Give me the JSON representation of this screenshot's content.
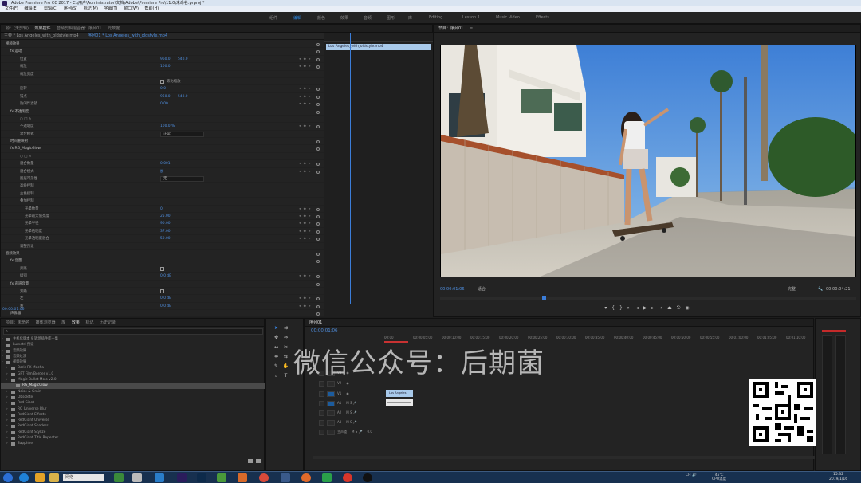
{
  "window": {
    "title": "Adobe Premiere Pro CC 2017 - C:\\用户\\Administrator\\文档\\Adobe\\Premiere Pro\\11.0\\未命名.prproj *"
  },
  "menu": [
    "文件(F)",
    "编辑(E)",
    "剪辑(C)",
    "序列(S)",
    "标记(M)",
    "字幕(T)",
    "窗口(W)",
    "帮助(H)"
  ],
  "workspaces": [
    "组件",
    "编辑",
    "颜色",
    "效果",
    "音频",
    "图形",
    "库",
    "Editing",
    "Lesson 1",
    "Music Video",
    "Effects"
  ],
  "workspace_active": "编辑",
  "effect_controls": {
    "tabs": [
      "源：(无剪辑)",
      "效果控件",
      "音频剪辑混合器：序列01",
      "元数据"
    ],
    "source_clip": "主要 * Los Angeles_with_oldstyle.mp4",
    "sequence_clip": "序列01 * Los Angeles_with_oldstyle.mp4",
    "timeline_clip": "Los Angeles_with_oldstyle.mp4",
    "timecode": "00:00:01:06",
    "rows": [
      {
        "label": "视频效果",
        "indent": 1,
        "section": true
      },
      {
        "label": "fx 运动",
        "indent": 2,
        "section": true
      },
      {
        "label": "位置",
        "indent": 4,
        "value": "960.0",
        "value2": "540.0"
      },
      {
        "label": "缩放",
        "indent": 4,
        "value": "100.0"
      },
      {
        "label": "缩放宽度",
        "indent": 4
      },
      {
        "label": "",
        "indent": 4,
        "check": "等比缩放"
      },
      {
        "label": "旋转",
        "indent": 4,
        "value": "0.0"
      },
      {
        "label": "锚点",
        "indent": 4,
        "value": "960.0",
        "value2": "540.0"
      },
      {
        "label": "防闪烁滤镜",
        "indent": 4,
        "value": "0.00"
      },
      {
        "label": "fx 不透明度",
        "indent": 2,
        "section": true
      },
      {
        "label": "○ □ ✎",
        "indent": 4
      },
      {
        "label": "不透明度",
        "indent": 4,
        "value": "100.0 %"
      },
      {
        "label": "混合模式",
        "indent": 4,
        "dropdown": "正常"
      },
      {
        "label": "时间重映射",
        "indent": 2,
        "section": true
      },
      {
        "label": "fx RG_MagicGlow",
        "indent": 2,
        "section": true
      },
      {
        "label": "○ □ ✎",
        "indent": 4
      },
      {
        "label": "混合数量",
        "indent": 4,
        "value": "0.001"
      },
      {
        "label": "混合模式",
        "indent": 4,
        "value": "加"
      },
      {
        "label": "图层可见性",
        "indent": 4,
        "dropdown": "无"
      },
      {
        "label": "高级控制",
        "indent": 4
      },
      {
        "label": "主色控制",
        "indent": 4
      },
      {
        "label": "叠加控制",
        "indent": 4
      },
      {
        "label": "光晕数量",
        "indent": 5,
        "value": "0"
      },
      {
        "label": "光晕最大值亮度",
        "indent": 5,
        "value": "25.00"
      },
      {
        "label": "光晕半径",
        "indent": 5,
        "value": "90.00"
      },
      {
        "label": "光晕透明度",
        "indent": 5,
        "value": "37.00"
      },
      {
        "label": "光晕透明度混合",
        "indent": 5,
        "value": "50.00"
      },
      {
        "label": "调整预设",
        "indent": 4
      },
      {
        "label": "音频效果",
        "indent": 1,
        "section": true
      },
      {
        "label": "fx 音量",
        "indent": 2,
        "section": true
      },
      {
        "label": "旁路",
        "indent": 4,
        "chk": true
      },
      {
        "label": "级别",
        "indent": 4,
        "value": "0.0 dB"
      },
      {
        "label": "fx 声道音量",
        "indent": 2,
        "section": true
      },
      {
        "label": "旁路",
        "indent": 4,
        "chk": true
      },
      {
        "label": "左",
        "indent": 4,
        "value": "0.0 dB"
      },
      {
        "label": "右",
        "indent": 4,
        "value": "0.0 dB"
      },
      {
        "label": "声像器",
        "indent": 2,
        "section": true
      },
      {
        "label": "平衡",
        "indent": 4,
        "value": "0.0"
      }
    ]
  },
  "program_monitor": {
    "tab": "节目：序列01",
    "timecode": "00:00:01:06",
    "fit_label": "适合",
    "full_label": "完整",
    "duration": "00:00:04:21"
  },
  "project_panel": {
    "tabs": [
      "项目：未命名",
      "媒体浏览器",
      "库",
      "效果",
      "标记",
      "历史记录"
    ],
    "active_tab": "效果",
    "search_placeholder": "",
    "items": [
      {
        "label": "主机化版本 9 转场插件库—集",
        "indent": 1
      },
      {
        "label": "Lumetri 预设",
        "indent": 1
      },
      {
        "label": "音频效果",
        "indent": 1
      },
      {
        "label": "音频过渡",
        "indent": 1
      },
      {
        "label": "视频效果",
        "indent": 1
      },
      {
        "label": "Boris FX Mocha",
        "indent": 2
      },
      {
        "label": "GPT Film Border v1.0",
        "indent": 2
      },
      {
        "label": "Magic Bullet Mojo v2.0",
        "indent": 2
      },
      {
        "label": "RG_MagicGlow",
        "indent": 3,
        "selected": true
      },
      {
        "label": "Noise & Grain",
        "indent": 2
      },
      {
        "label": "Obsolete",
        "indent": 2
      },
      {
        "label": "Red Giant",
        "indent": 2
      },
      {
        "label": "RG Universe Blur",
        "indent": 2
      },
      {
        "label": "RedGiant Effects",
        "indent": 2
      },
      {
        "label": "RedGiant Universe",
        "indent": 2
      },
      {
        "label": "RedGiant Shaders",
        "indent": 2
      },
      {
        "label": "RedGiant Stylize",
        "indent": 2
      },
      {
        "label": "RedGiant Title Repeater",
        "indent": 2
      },
      {
        "label": "Sapphire",
        "indent": 2
      }
    ]
  },
  "timeline": {
    "tab": "序列01",
    "timecode": "00:00:01:06",
    "ruler": [
      "00:00",
      "00:00:05:00",
      "00:00:10:00",
      "00:00:15:00",
      "00:00:20:00",
      "00:00:25:00",
      "00:00:30:00",
      "00:00:35:00",
      "00:00:40:00",
      "00:00:45:00",
      "00:00:50:00",
      "00:00:55:00",
      "00:01:00:00",
      "00:01:05:00",
      "00:01:10:00",
      "00:01:15:00"
    ],
    "tracks": [
      "V3",
      "V2",
      "V1",
      "A1",
      "A2",
      "A3",
      "主声道"
    ],
    "clip_label": "Los Angeles",
    "master_value": "0.0"
  },
  "watermark": "微信公众号：后期菌",
  "taskbar": {
    "search_text": "网络",
    "tray_text": "CH 🔊",
    "cpu_temp": "45℃",
    "cpu_label": "CPU温度",
    "time": "15:32",
    "date": "2019/1/16"
  },
  "colors": {
    "accent": "#2d8ceb",
    "clip": "#a8c9ea",
    "panel_bg": "#232323"
  }
}
